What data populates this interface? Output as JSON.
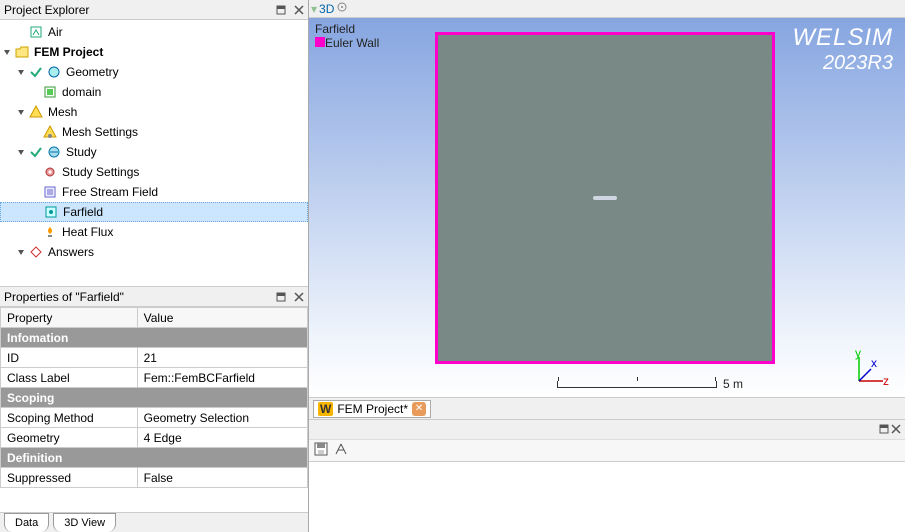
{
  "explorer": {
    "title": "Project Explorer",
    "nodes": {
      "air": "Air",
      "project": "FEM Project",
      "geometry": "Geometry",
      "domain": "domain",
      "mesh": "Mesh",
      "mesh_settings": "Mesh Settings",
      "study": "Study",
      "study_settings": "Study Settings",
      "free_stream": "Free Stream Field",
      "farfield": "Farfield",
      "heat_flux": "Heat Flux",
      "answers": "Answers"
    }
  },
  "properties": {
    "title": "Properties of \"Farfield\"",
    "headers": {
      "col1": "Property",
      "col2": "Value"
    },
    "groups": {
      "information": "Infomation",
      "scoping": "Scoping",
      "definition": "Definition"
    },
    "rows": {
      "id": {
        "k": "ID",
        "v": "21"
      },
      "class": {
        "k": "Class Label",
        "v": "Fem::FemBCFarfield"
      },
      "method": {
        "k": "Scoping Method",
        "v": "Geometry Selection"
      },
      "geometry": {
        "k": "Geometry",
        "v": "4 Edge"
      },
      "suppressed": {
        "k": "Suppressed",
        "v": "False"
      }
    },
    "tabs": {
      "data": "Data",
      "view": "3D View"
    }
  },
  "viewport": {
    "mode_label": "3D",
    "legend": {
      "farfield": "Farfield",
      "euler": "Euler Wall"
    },
    "colors": {
      "euler": "#ff00cc"
    },
    "brand": {
      "name": "WELSIM",
      "version": "2023R3"
    },
    "scale_label": "5 m",
    "axes": {
      "y": "y",
      "z": "z",
      "x": "x"
    }
  },
  "doc_tab": {
    "icon": "W",
    "label": "FEM Project*"
  }
}
